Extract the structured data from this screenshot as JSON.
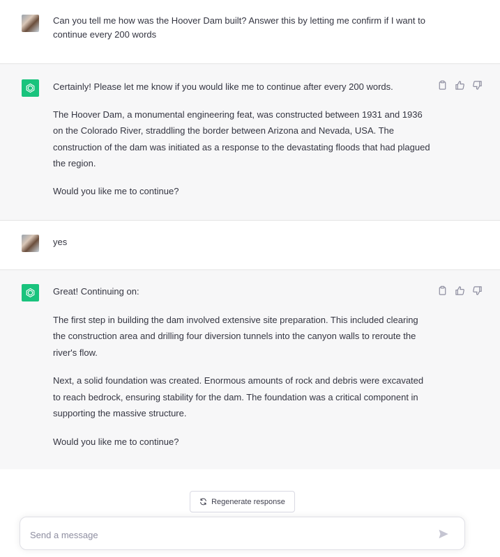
{
  "conversation": [
    {
      "role": "user",
      "paragraphs": [
        "Can you tell me how was the Hoover Dam built? Answer this by letting me confirm if I want to continue every 200 words"
      ]
    },
    {
      "role": "assistant",
      "paragraphs": [
        "Certainly! Please let me know if you would like me to continue after every 200 words.",
        "The Hoover Dam, a monumental engineering feat, was constructed between 1931 and 1936 on the Colorado River, straddling the border between Arizona and Nevada, USA. The construction of the dam was initiated as a response to the devastating floods that had plagued the region.",
        "Would you like me to continue?"
      ]
    },
    {
      "role": "user",
      "paragraphs": [
        "yes"
      ]
    },
    {
      "role": "assistant",
      "paragraphs": [
        "Great! Continuing on:",
        "The first step in building the dam involved extensive site preparation. This included clearing the construction area and drilling four diversion tunnels into the canyon walls to reroute the river's flow.",
        "Next, a solid foundation was created. Enormous amounts of rock and debris were excavated to reach bedrock, ensuring stability for the dam. The foundation was a critical component in supporting the massive structure.",
        "Would you like me to continue?"
      ]
    }
  ],
  "regenerate_label": "Regenerate response",
  "composer": {
    "placeholder": "Send a message"
  },
  "colors": {
    "gpt_accent": "#19c37d",
    "assistant_bg": "#f7f7f8",
    "text": "#343541"
  },
  "icons": [
    "copy-icon",
    "thumbs-up-icon",
    "thumbs-down-icon",
    "refresh-icon",
    "send-icon",
    "openai-logo-icon"
  ]
}
